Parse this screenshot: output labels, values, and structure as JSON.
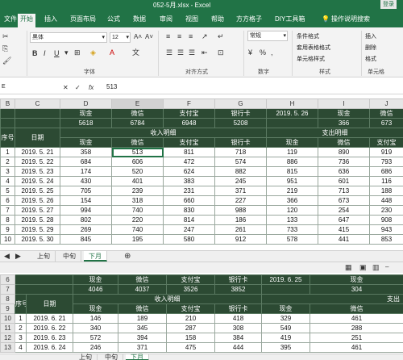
{
  "titlebar": {
    "title": "052-5月.xlsx - Excel",
    "login": "登录"
  },
  "tabs": [
    "文件",
    "开始",
    "插入",
    "页面布局",
    "公式",
    "数据",
    "审阅",
    "视图",
    "帮助",
    "方方格子",
    "DIY工具箱",
    "操作说明搜索"
  ],
  "ribbon": {
    "font_name": "黑体",
    "font_size": "12",
    "font_label": "字体",
    "align_label": "对齐方式",
    "number_format": "常规",
    "number_label": "数字",
    "cond_format": "条件格式",
    "table_format": "套用表格格式",
    "cell_style": "单元格样式",
    "style_label": "样式",
    "insert": "插入",
    "delete": "删除",
    "format": "格式",
    "cells_label": "单元格",
    "bold": "B",
    "italic": "I",
    "underline": "U",
    "pct": "%",
    "comma": ",",
    "font_A": "A"
  },
  "formula": {
    "cell_ref": "E",
    "fx": "fx",
    "value": "513"
  },
  "col_headers": [
    "B",
    "C",
    "D",
    "E",
    "F",
    "G",
    "H",
    "I",
    "J"
  ],
  "top": {
    "row_a": [
      "",
      "",
      "现金",
      "微信",
      "支付宝",
      "银行卡",
      "2019. 5. 26",
      "现金",
      "微信"
    ],
    "row_b": [
      "",
      "",
      "5618",
      "6784",
      "6948",
      "5208",
      "",
      "366",
      "673"
    ],
    "income_title": "收入明细",
    "expense_title": "支出明细",
    "seq": "序号",
    "date": "日期",
    "sub": [
      "现金",
      "微信",
      "支付宝",
      "银行卡",
      "现金",
      "微信",
      "支付宝"
    ],
    "rows": [
      [
        "1",
        "2019. 5. 21",
        "358",
        "513",
        "811",
        "718",
        "119",
        "890",
        "919"
      ],
      [
        "2",
        "2019. 5. 22",
        "684",
        "606",
        "472",
        "574",
        "886",
        "736",
        "793"
      ],
      [
        "3",
        "2019. 5. 23",
        "174",
        "520",
        "624",
        "882",
        "815",
        "636",
        "686"
      ],
      [
        "4",
        "2019. 5. 24",
        "430",
        "401",
        "383",
        "245",
        "951",
        "601",
        "116"
      ],
      [
        "5",
        "2019. 5. 25",
        "705",
        "239",
        "231",
        "371",
        "219",
        "713",
        "188"
      ],
      [
        "6",
        "2019. 5. 26",
        "154",
        "318",
        "660",
        "227",
        "366",
        "673",
        "448"
      ],
      [
        "7",
        "2019. 5. 27",
        "994",
        "740",
        "830",
        "988",
        "120",
        "254",
        "230"
      ],
      [
        "8",
        "2019. 5. 28",
        "802",
        "220",
        "814",
        "186",
        "133",
        "647",
        "908"
      ],
      [
        "9",
        "2019. 5. 29",
        "269",
        "740",
        "247",
        "261",
        "733",
        "415",
        "943"
      ],
      [
        "10",
        "2019. 5. 30",
        "845",
        "195",
        "580",
        "912",
        "578",
        "441",
        "853"
      ]
    ],
    "sheets": [
      "上旬",
      "中旬",
      "下月"
    ]
  },
  "bottom": {
    "row_nums": [
      "6",
      "7",
      "8",
      "9",
      "10",
      "11",
      "12",
      "13"
    ],
    "row_a": [
      "",
      "",
      "现金",
      "微信",
      "支付宝",
      "银行卡",
      "2019. 6. 25",
      "现金"
    ],
    "row_b": [
      "",
      "",
      "4046",
      "4037",
      "3526",
      "3852",
      "",
      "304"
    ],
    "income_title": "收入明细",
    "expense_title": "支出",
    "seq": "序号",
    "date": "日期",
    "sub": [
      "现金",
      "微信",
      "支付宝",
      "银行卡",
      "现金",
      "微信"
    ],
    "rows": [
      [
        "1",
        "2019. 6. 21",
        "146",
        "189",
        "210",
        "418",
        "329",
        "461"
      ],
      [
        "2",
        "2019. 6. 22",
        "340",
        "345",
        "287",
        "308",
        "549",
        "288"
      ],
      [
        "3",
        "2019. 6. 23",
        "572",
        "394",
        "158",
        "384",
        "419",
        "251"
      ],
      [
        "4",
        "2019. 6. 24",
        "246",
        "371",
        "475",
        "444",
        "395",
        "461"
      ]
    ],
    "sheets": [
      "上旬",
      "中旬",
      "下月"
    ]
  }
}
